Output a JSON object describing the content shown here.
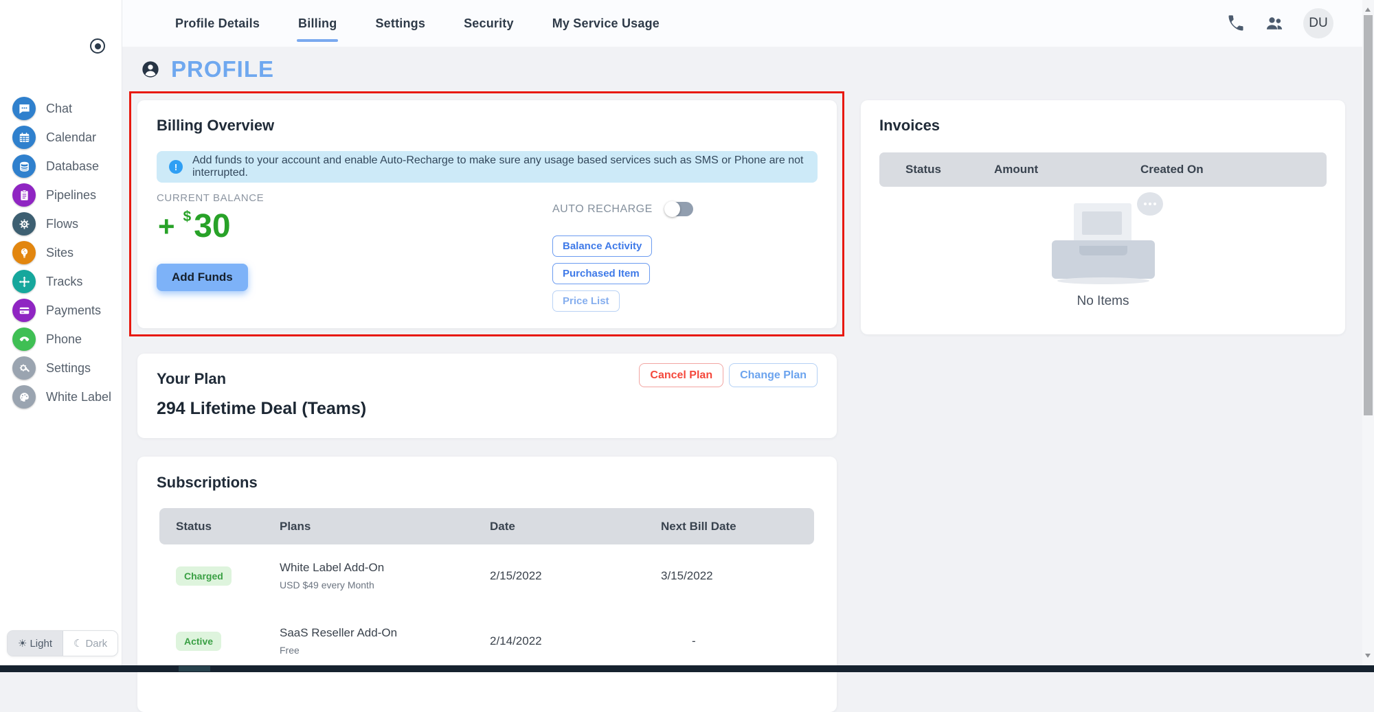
{
  "header": {
    "tabs": [
      {
        "label": "Profile Details"
      },
      {
        "label": "Billing"
      },
      {
        "label": "Settings"
      },
      {
        "label": "Security"
      },
      {
        "label": "My Service Usage"
      }
    ],
    "avatar_initials": "DU"
  },
  "page_title": "PROFILE",
  "sidebar": {
    "items": [
      {
        "label": "Chat",
        "icon": "chat-icon",
        "color": "#2f80cd"
      },
      {
        "label": "Calendar",
        "icon": "calendar-icon",
        "color": "#2f80cd"
      },
      {
        "label": "Database",
        "icon": "database-icon",
        "color": "#2f80cd"
      },
      {
        "label": "Pipelines",
        "icon": "pipelines-icon",
        "color": "#8f25c2"
      },
      {
        "label": "Flows",
        "icon": "flows-icon",
        "color": "#3d5f71"
      },
      {
        "label": "Sites",
        "icon": "sites-icon",
        "color": "#e2860f"
      },
      {
        "label": "Tracks",
        "icon": "tracks-icon",
        "color": "#16a79c"
      },
      {
        "label": "Payments",
        "icon": "payments-icon",
        "color": "#8f25c2"
      },
      {
        "label": "Phone",
        "icon": "phone-icon",
        "color": "#3fbf54"
      },
      {
        "label": "Settings",
        "icon": "settings-icon",
        "color": "#9aa4b0"
      },
      {
        "label": "White Label",
        "icon": "white-label-icon",
        "color": "#9aa4b0"
      }
    ]
  },
  "theme": {
    "light_icon": "☀",
    "light_label": "Light",
    "dark_icon": "☾",
    "dark_label": "Dark"
  },
  "billing_overview": {
    "title": "Billing Overview",
    "info_icon": "!",
    "info_text": "Add funds to your account and enable Auto-Recharge to make sure any usage based services such as SMS or Phone are not interrupted.",
    "current_balance_label": "CURRENT BALANCE",
    "balance_sign": "+",
    "balance_currency": "$",
    "balance_amount": "30",
    "add_funds_label": "Add Funds",
    "auto_recharge_label": "AUTO RECHARGE",
    "auto_recharge_state": "off",
    "buttons": [
      {
        "label": "Balance Activity"
      },
      {
        "label": "Purchased Item"
      },
      {
        "label": "Price List"
      }
    ]
  },
  "invoices": {
    "title": "Invoices",
    "columns": [
      "Status",
      "Amount",
      "Created On"
    ],
    "empty_text": "No Items"
  },
  "your_plan": {
    "title": "Your Plan",
    "plan_name": "294 Lifetime Deal (Teams)",
    "cancel_label": "Cancel Plan",
    "change_label": "Change Plan"
  },
  "subscriptions": {
    "title": "Subscriptions",
    "columns": [
      "Status",
      "Plans",
      "Date",
      "Next Bill Date"
    ],
    "rows": [
      {
        "status": "Charged",
        "plan": "White Label Add-On",
        "plan_sub": "USD $49 every Month",
        "date": "2/15/2022",
        "next_bill_date": "3/15/2022"
      },
      {
        "status": "Active",
        "plan": "SaaS Reseller Add-On",
        "plan_sub": "Free",
        "date": "2/14/2022",
        "next_bill_date": "-"
      }
    ]
  },
  "colors": {
    "accent_blue": "#7aa9ef",
    "title_blue": "#6fa8ef",
    "balance_green": "#28a228",
    "badge_green_bg": "#def4dd",
    "badge_green_text": "#3aa044",
    "banner_bg": "#cdeaf8",
    "danger_red": "#f4483c",
    "highlight_red": "#e8190f",
    "table_head_bg": "#d9dce1",
    "bottom_bar": "#16222f"
  }
}
